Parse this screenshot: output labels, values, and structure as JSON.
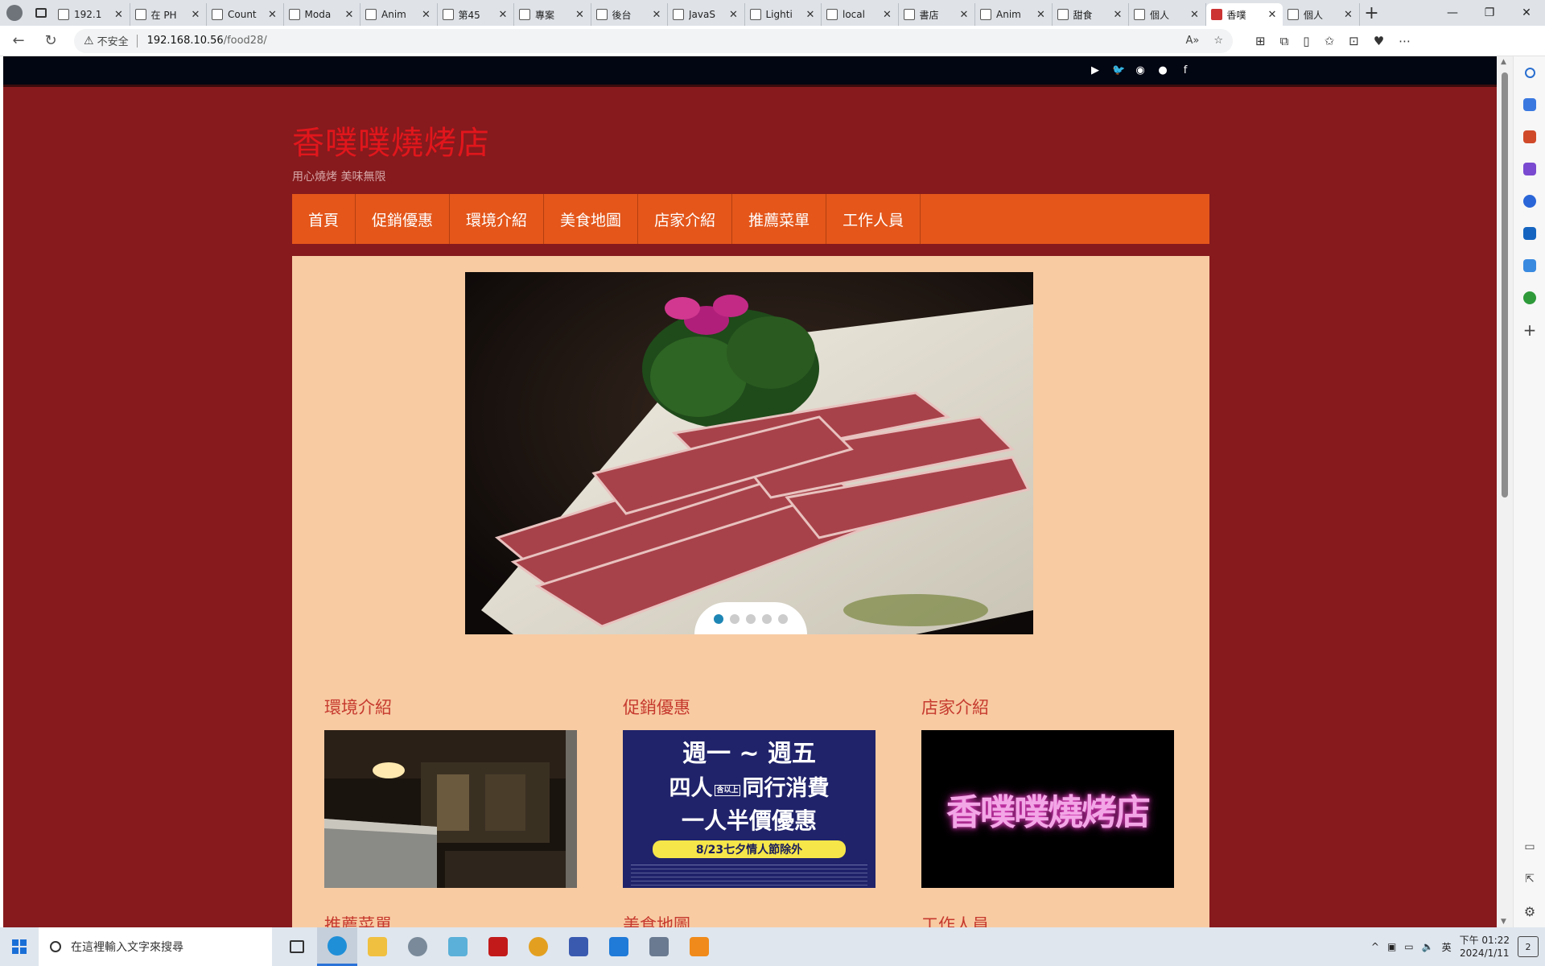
{
  "browser": {
    "tabs": [
      {
        "title": "192.1"
      },
      {
        "title": "在 PH"
      },
      {
        "title": "Count"
      },
      {
        "title": "Moda"
      },
      {
        "title": "Anim"
      },
      {
        "title": "第45"
      },
      {
        "title": "專案"
      },
      {
        "title": "後台"
      },
      {
        "title": "JavaS"
      },
      {
        "title": "Lighti"
      },
      {
        "title": "local"
      },
      {
        "title": "書店"
      },
      {
        "title": "Anim"
      },
      {
        "title": "甜食"
      },
      {
        "title": "個人"
      },
      {
        "title": "香噗"
      },
      {
        "title": "個人"
      }
    ],
    "active_tab_index": 15,
    "address": {
      "security_label": "不安全",
      "host": "192.168.10.56",
      "path": "/food28/"
    }
  },
  "site": {
    "social_icons": [
      "youtube-icon",
      "twitter-icon",
      "rss-icon",
      "user-icon",
      "facebook-icon"
    ],
    "title": "香噗噗燒烤店",
    "tagline": "用心燒烤 美味無限",
    "menu": [
      "首頁",
      "促銷優惠",
      "環境介紹",
      "美食地圖",
      "店家介紹",
      "推薦菜單",
      "工作人員"
    ],
    "slider": {
      "slide_count": 5,
      "active_slide": 1
    },
    "sections_row1": [
      {
        "title": "環境介紹",
        "image": "restaurant-interior-photo"
      },
      {
        "title": "促銷優惠",
        "image": "promotion-poster",
        "poster_line1": "週一 ~ 週五",
        "poster_line2_left": "四人",
        "poster_line2_mark": "含以上",
        "poster_line2_right": "同行消費",
        "poster_line3": "一人半價優惠",
        "poster_banner": "8/23七夕情人節除外"
      },
      {
        "title": "店家介紹",
        "image": "store-logo-neon",
        "logo_text": "香噗噗燒烤店"
      }
    ],
    "sections_row2": [
      {
        "title": "推薦菜單"
      },
      {
        "title": "美食地圖"
      },
      {
        "title": "工作人員"
      }
    ]
  },
  "taskbar": {
    "search_placeholder": "在這裡輸入文字來搜尋",
    "ime": "英",
    "time": "下午 01:22",
    "date": "2024/1/11",
    "notifications": "2"
  }
}
